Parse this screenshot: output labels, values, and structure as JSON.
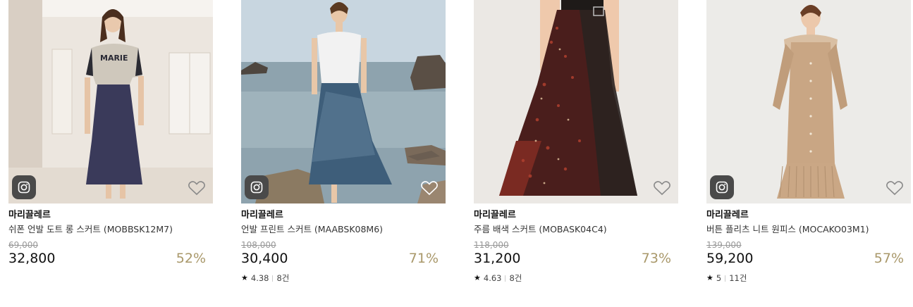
{
  "products": [
    {
      "brand": "마리끌레르",
      "name": "쉬폰 언발 도트 롱 스커트 (MOBBSK12M7)",
      "original_price": "69,000",
      "price": "32,800",
      "discount": "52%",
      "rating": null,
      "reviews": null
    },
    {
      "brand": "마리끌레르",
      "name": "언발 프린트 스커트 (MAABSK08M6)",
      "original_price": "108,000",
      "price": "30,400",
      "discount": "71%",
      "rating": "4.38",
      "reviews": "8건"
    },
    {
      "brand": "마리끌레르",
      "name": "주름 배색 스커트 (MOBASK04C4)",
      "original_price": "118,000",
      "price": "31,200",
      "discount": "73%",
      "rating": "4.63",
      "reviews": "8건"
    },
    {
      "brand": "마리끌레르",
      "name": "버튼 플리츠 니트 원피스 (MOCAKO03M1)",
      "original_price": "139,000",
      "price": "59,200",
      "discount": "57%",
      "rating": "5",
      "reviews": "11건"
    }
  ],
  "photo1_tshirt_text": "MARIE",
  "icons": {
    "instagram": "instagram-icon",
    "wishlist": "heart-outline-icon",
    "star": "star-icon"
  },
  "colors": {
    "discount": "#a9986a",
    "insta_badge": "#4a4a4a",
    "original_price": "#999999"
  }
}
